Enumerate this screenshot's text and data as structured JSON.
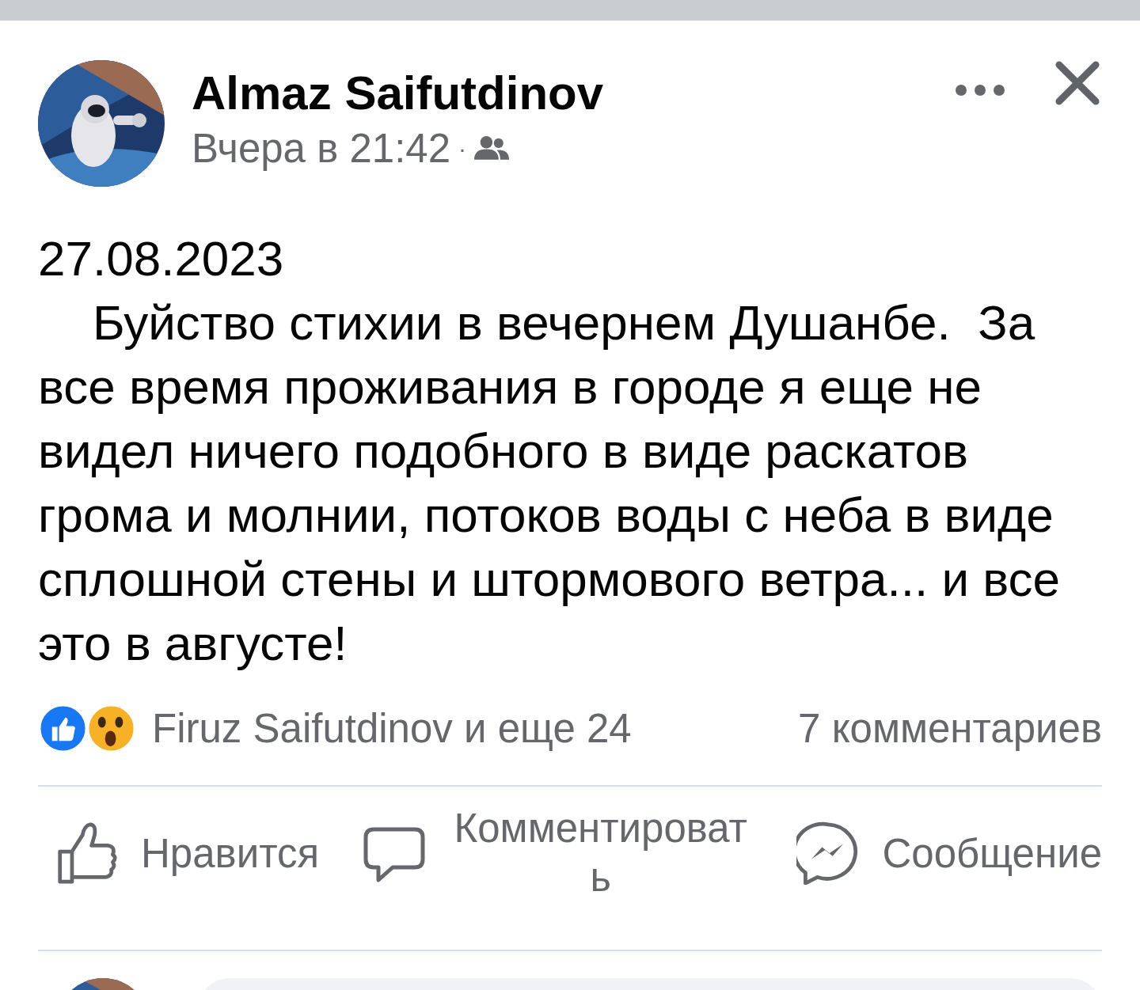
{
  "post": {
    "author": "Almaz Saifutdinov",
    "time": "Вчера в 21:42",
    "separator": "·",
    "text": "27.08.2023\n    Буйство стихии в вечернем Душанбе.  За все время проживания в городе я еще не видел ничего подобного в виде раскатов грома и молнии, потоков воды с неба в виде сплошной стены и штормового ветра... и все это в августе!"
  },
  "reactions": {
    "summary": "Firuz Saifutdinov и еще 24",
    "comments": "7 комментариев"
  },
  "actions": [
    {
      "kind": "like",
      "label": "Нравится"
    },
    {
      "kind": "comment",
      "label": "Комментировать"
    },
    {
      "kind": "message",
      "label": "Сообщение"
    }
  ]
}
